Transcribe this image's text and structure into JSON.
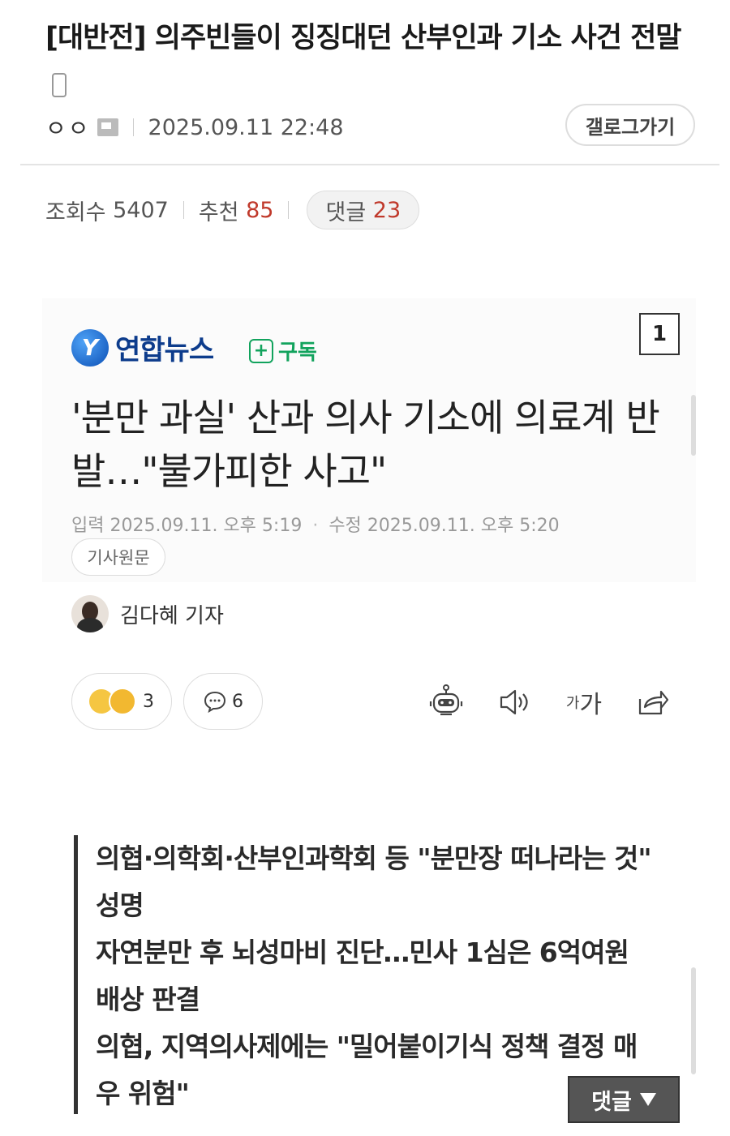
{
  "post": {
    "title_main": "[대반전] 의주빈들이 징징대던 산부인과 기소 사건 전말",
    "author": "ㅇㅇ",
    "datetime": "2025.09.11 22:48",
    "gallery_button": "갤로그가기",
    "views_label": "조회수",
    "views": "5407",
    "recommend_label": "추천",
    "recommend": "85",
    "comments_label": "댓글",
    "comments": "23"
  },
  "article": {
    "source_logo_mark": "Y",
    "source_name": "연합뉴스",
    "subscribe_label": "구독",
    "page_number": "1",
    "headline": "'분만 과실' 산과 의사 기소에 의료계 반발…\"불가피한 사고\"",
    "input_label": "입력",
    "input_date": "2025.09.11. 오후 5:19",
    "modified_label": "수정",
    "modified_date": "2025.09.11. 오후 5:20",
    "source_button": "기사원문",
    "reporter": "김다혜 기자",
    "reaction_count": "3",
    "comment_count": "6",
    "font_tool_label_small": "가",
    "font_tool_label_large": "가"
  },
  "summary": {
    "lines": [
      "의협·의학회·산부인과학회 등 \"분만장 떠나라는 것\" 성명",
      "자연분만 후 뇌성마비 진단…민사 1심은 6억여원 배상 판결",
      "의협, 지역의사제에는 \"밀어붙이기식 정책 결정 매우 위험\""
    ]
  },
  "floating": {
    "comment_button": "댓글"
  },
  "colors": {
    "accent_red": "#c0392b",
    "subscribe_green": "#12a35d",
    "yonhap_blue": "#0d3c8c"
  }
}
